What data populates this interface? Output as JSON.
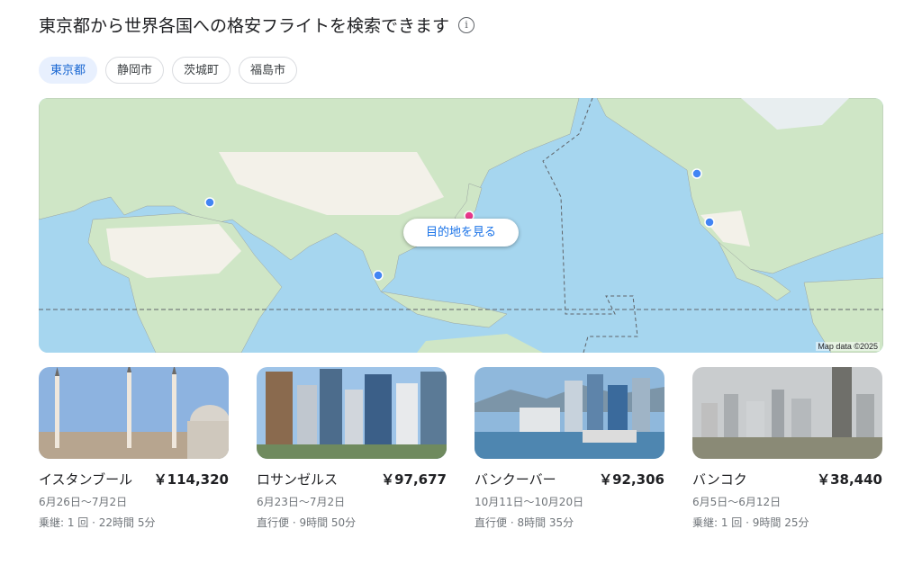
{
  "header": {
    "title": "東京都から世界各国への格安フライトを検索できます",
    "info_icon": "info-icon"
  },
  "origins": [
    {
      "label": "東京都",
      "selected": true
    },
    {
      "label": "静岡市",
      "selected": false
    },
    {
      "label": "茨城町",
      "selected": false
    },
    {
      "label": "福島市",
      "selected": false
    }
  ],
  "map": {
    "cta_label": "目的地を見る",
    "credit": "Map data ©2025",
    "colors": {
      "ocean": "#a6d6ef",
      "land": "#cfe6c6",
      "desert": "#f3f1e9",
      "pin": "#4285f4",
      "origin_pin": "#e8388b"
    }
  },
  "destinations": [
    {
      "city": "イスタンブール",
      "price": "￥114,320",
      "dates": "6月26日〜7月2日",
      "route": "乗継: 1 回 · 22時間 5分"
    },
    {
      "city": "ロサンゼルス",
      "price": "￥97,677",
      "dates": "6月23日〜7月2日",
      "route": "直行便 · 9時間 50分"
    },
    {
      "city": "バンクーバー",
      "price": "￥92,306",
      "dates": "10月11日〜10月20日",
      "route": "直行便 · 8時間 35分"
    },
    {
      "city": "バンコク",
      "price": "￥38,440",
      "dates": "6月5日〜6月12日",
      "route": "乗継: 1 回 · 9時間 25分"
    }
  ]
}
